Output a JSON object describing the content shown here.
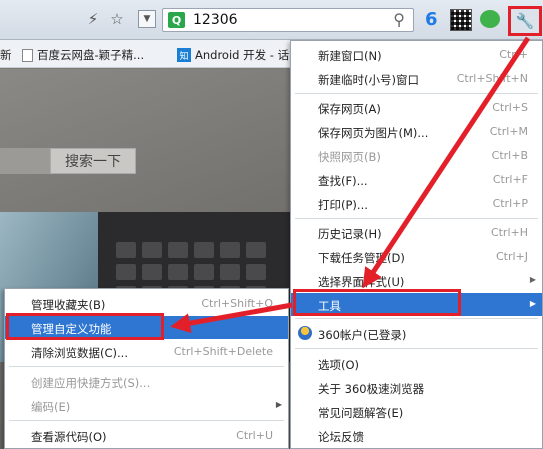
{
  "toolbar": {
    "address_text": "12306",
    "address_badge": "Q",
    "tb_360_label": "6"
  },
  "bookmarks": {
    "partial_left": "新",
    "item1": "百度云网盘-颖子精...",
    "item2": "Android 开发 - 话"
  },
  "page": {
    "search_button": "搜索一下"
  },
  "main_menu": {
    "items": [
      {
        "label": "新建窗口(N)",
        "shortcut": "Ctrl+"
      },
      {
        "label": "新建临时(小号)窗口",
        "shortcut": "Ctrl+Shift+N"
      },
      {
        "label": "保存网页(A)",
        "shortcut": "Ctrl+S"
      },
      {
        "label": "保存网页为图片(M)...",
        "shortcut": "Ctrl+M"
      },
      {
        "label": "快照网页(B)",
        "shortcut": "Ctrl+B"
      },
      {
        "label": "查找(F)...",
        "shortcut": "Ctrl+F"
      },
      {
        "label": "打印(P)...",
        "shortcut": "Ctrl+P"
      },
      {
        "label": "历史记录(H)",
        "shortcut": "Ctrl+H"
      },
      {
        "label": "下载任务管理(D)",
        "shortcut": "Ctrl+J"
      },
      {
        "label": "选择界面样式(U)",
        "shortcut": ""
      },
      {
        "label": "工具",
        "shortcut": ""
      },
      {
        "label": "360帐户(已登录)",
        "shortcut": ""
      },
      {
        "label": "选项(O)",
        "shortcut": ""
      },
      {
        "label": "关于 360极速浏览器",
        "shortcut": ""
      },
      {
        "label": "常见问题解答(E)",
        "shortcut": ""
      },
      {
        "label": "论坛反馈",
        "shortcut": ""
      }
    ]
  },
  "sub_menu": {
    "items": [
      {
        "label": "管理收藏夹(B)",
        "shortcut": "Ctrl+Shift+O"
      },
      {
        "label": "管理自定义功能",
        "shortcut": ""
      },
      {
        "label": "清除浏览数据(C)...",
        "shortcut": "Ctrl+Shift+Delete"
      },
      {
        "label": "创建应用快捷方式(S)...",
        "shortcut": ""
      },
      {
        "label": "编码(E)",
        "shortcut": ""
      },
      {
        "label": "查看源代码(O)",
        "shortcut": "Ctrl+U"
      }
    ]
  },
  "colors": {
    "highlight": "#2e76d2",
    "annotation_red": "#e3202a"
  },
  "icons": [
    "lightning-icon",
    "star-icon",
    "dropdown-icon",
    "search-icon",
    "360-icon",
    "qr-icon",
    "wechat-icon",
    "wrench-icon",
    "user-icon",
    "arrow-icon"
  ]
}
